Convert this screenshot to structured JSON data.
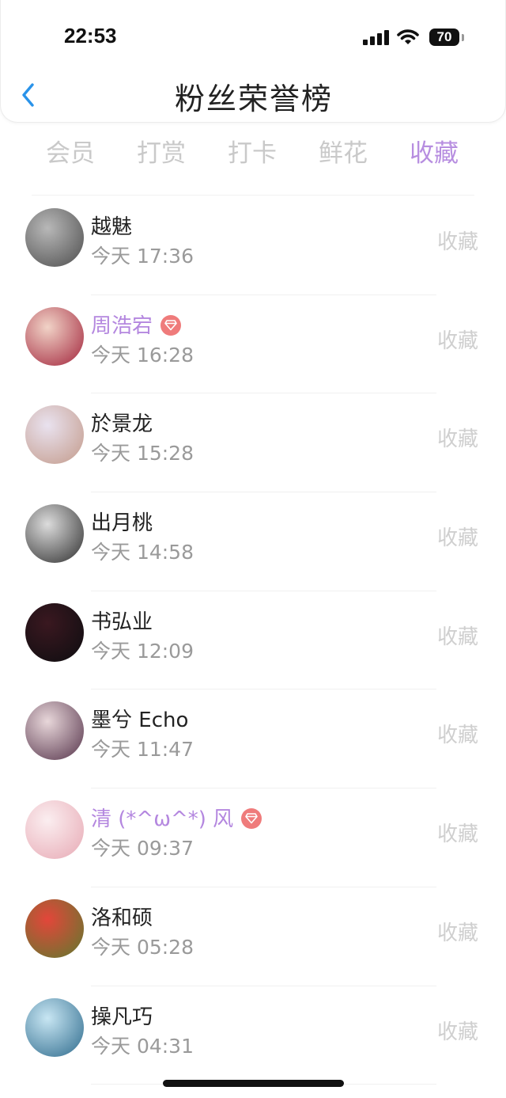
{
  "status_bar": {
    "time": "22:53",
    "battery": "70"
  },
  "header": {
    "title": "粉丝荣誉榜",
    "back_icon": "chevron-left-icon"
  },
  "colors": {
    "accent": "#b78ee0",
    "vip_badge": "#ef7b7b",
    "back_icon": "#2a93e9"
  },
  "tabs": [
    {
      "label": "会员",
      "active": false
    },
    {
      "label": "打赏",
      "active": false
    },
    {
      "label": "打卡",
      "active": false
    },
    {
      "label": "鲜花",
      "active": false
    },
    {
      "label": "收藏",
      "active": true
    }
  ],
  "fans": [
    {
      "name": "越魅",
      "time": "今天 17:36",
      "action": "收藏",
      "vip": false,
      "avatar": [
        "#b8b8b8",
        "#4d4d4d"
      ]
    },
    {
      "name": "周浩宕",
      "time": "今天 16:28",
      "action": "收藏",
      "vip": true,
      "avatar": [
        "#f1d3c7",
        "#a2243b"
      ]
    },
    {
      "name": "於景龙",
      "time": "今天 15:28",
      "action": "收藏",
      "vip": false,
      "avatar": [
        "#e9e2ef",
        "#c39a8a"
      ]
    },
    {
      "name": "出月桃",
      "time": "今天 14:58",
      "action": "收藏",
      "vip": false,
      "avatar": [
        "#dcdcdc",
        "#2e2e2e"
      ]
    },
    {
      "name": "书弘业",
      "time": "今天 12:09",
      "action": "收藏",
      "vip": false,
      "avatar": [
        "#3a1820",
        "#0d0d10"
      ]
    },
    {
      "name": "墨兮 Echo",
      "time": "今天 11:47",
      "action": "收藏",
      "vip": false,
      "avatar": [
        "#e8d7da",
        "#55334a"
      ]
    },
    {
      "name": "清 (*^ω^*) 风",
      "time": "今天 09:37",
      "action": "收藏",
      "vip": true,
      "avatar": [
        "#fbeef0",
        "#e7a9b4"
      ]
    },
    {
      "name": "洛和硕",
      "time": "今天 05:28",
      "action": "收藏",
      "vip": false,
      "avatar": [
        "#e3463a",
        "#5e7a2e"
      ]
    },
    {
      "name": "操凡巧",
      "time": "今天 04:31",
      "action": "收藏",
      "vip": false,
      "avatar": [
        "#c8e6f3",
        "#2d6a8c"
      ]
    }
  ]
}
